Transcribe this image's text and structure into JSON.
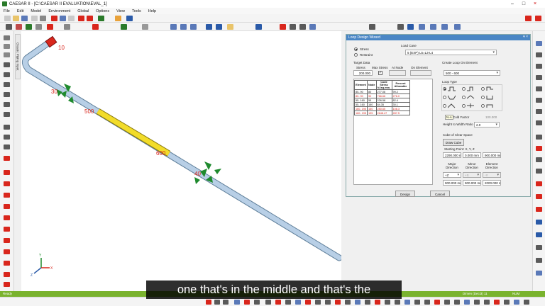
{
  "window": {
    "title": "CAESAR II - [C:\\CAESAR II EVALUATION\\EVAL_1]",
    "controls": [
      "–",
      "□",
      "×"
    ]
  },
  "menu": [
    "File",
    "Edit",
    "Model",
    "Environment",
    "Global",
    "Options",
    "View",
    "Tools",
    "Help"
  ],
  "side_tab": "Classic Piping Input",
  "viewport": {
    "node_labels": [
      {
        "text": "10",
        "color": "#d9261c"
      },
      {
        "text": "30",
        "color": "#d9261c"
      },
      {
        "text": "500",
        "color": "#d9261c"
      },
      {
        "text": "600",
        "color": "#d9261c"
      },
      {
        "text": "40",
        "color": "#d9261c"
      }
    ],
    "axis": {
      "x": "X",
      "y": "Y",
      "z": "Z"
    },
    "pipe_color": "#b8cfe6",
    "highlight_color": "#f2dc2a",
    "restraint_color": "#1f8a2e"
  },
  "dialog": {
    "title": "Loop Design Wizard",
    "title_controls": "▾ ×",
    "mode_options": [
      "Stress",
      "Restraint"
    ],
    "mode_selected": "Stress",
    "load_case_label": "Load Case",
    "load_case_value": "5 (EXP) L5=L3-L4",
    "target_label": "Target Data",
    "stress_label": "Stress",
    "stress_value": "200.000",
    "max_stress_label": "Max Stress",
    "max_stress_checked": "✓",
    "at_node_label": "At Node",
    "on_element_label": "On Element",
    "table": {
      "headers": [
        "Element",
        "Node",
        "Code Stress N./sq.mm.",
        "Percent Allowable"
      ],
      "rows": [
        {
          "element": "80- 90",
          "node": "80",
          "stress": "277.06",
          "percent": "99.2",
          "flag": "black"
        },
        {
          "element": "80- 90",
          "node": "90",
          "stress": "766.66",
          "percent": "276.0",
          "flag": "red"
        },
        {
          "element": "55- 160",
          "node": "55",
          "stress": "226.58",
          "percent": "82.4",
          "flag": "black"
        },
        {
          "element": "55- 160",
          "node": "160",
          "stress": "84.35",
          "percent": "30.1",
          "flag": "black"
        },
        {
          "element": "160- 195",
          "node": "160",
          "stress": "280.65",
          "percent": "108.3",
          "flag": "red"
        },
        {
          "element": "160- 195",
          "node": "195",
          "stress": "2648.47",
          "percent": "287.5",
          "flag": "red"
        }
      ]
    },
    "create_loop_label": "Create Loop On Element",
    "create_loop_value": "500 - 600",
    "loop_type_label": "Loop Type",
    "loop_type_tooltip": "N-A",
    "cold_factor_label": "Cold Factor",
    "cold_factor_value": "100.000",
    "ratio_label": "Height to Width Ratio",
    "ratio_value": "2.0",
    "cube_label": "Cube of Clear Space",
    "draw_cube": "Draw Cube",
    "start_point_label": "Starting Point: X, Y, Z",
    "start_point_values": [
      "2290.000 mm",
      "0.000 mm",
      "900.000 mm"
    ],
    "dir_headers": [
      "Major Direction",
      "Minor Direction",
      "Element Direction"
    ],
    "dir_values": [
      "+Z",
      "+X",
      "-Y"
    ],
    "dim_values": [
      "900.000 mm",
      "900.000 mm",
      "2000.000 mm"
    ],
    "design_button": "Design",
    "cancel_button": "Cancel"
  },
  "status": {
    "left": "Ready",
    "right1": "Dimen (Deci3) 11",
    "right2": "NUM"
  },
  "caption": "one that's in the middle and that's the"
}
